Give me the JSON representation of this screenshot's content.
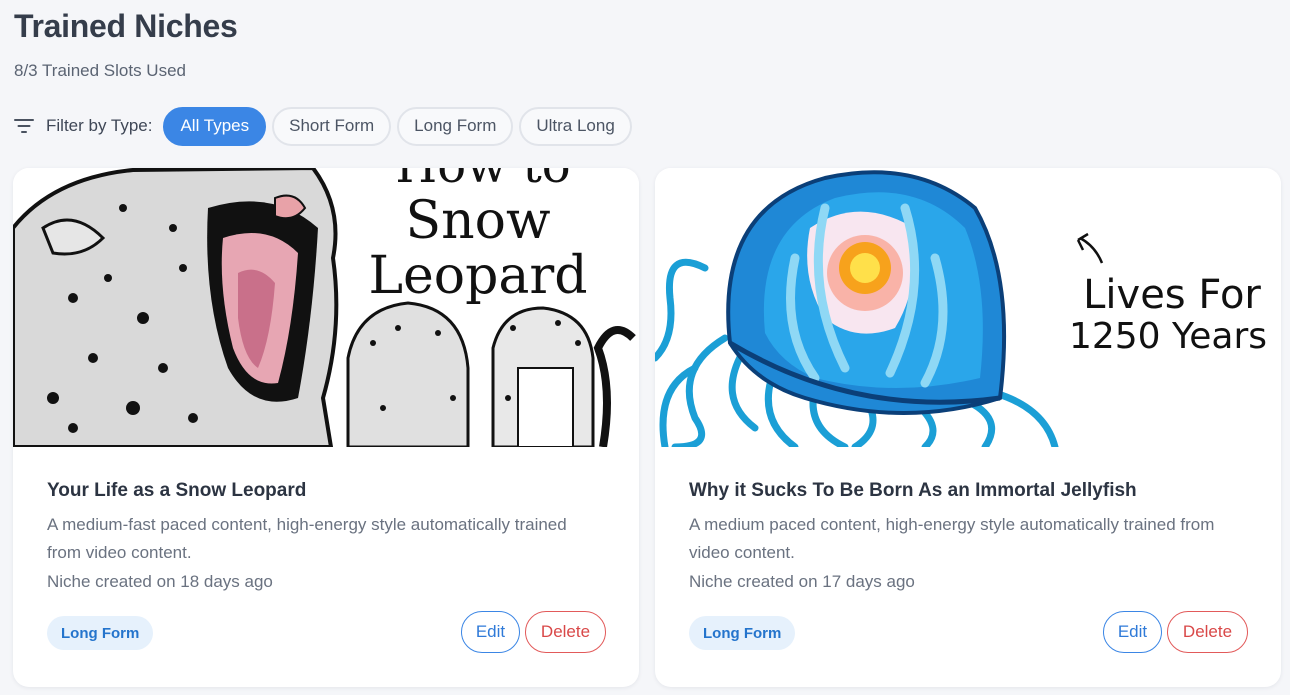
{
  "header": {
    "title": "Trained Niches",
    "slots_text": "8/3 Trained Slots Used"
  },
  "filter": {
    "label": "Filter by Type:",
    "icon": "filter-icon",
    "options": [
      "All Types",
      "Short Form",
      "Long Form",
      "Ultra Long"
    ],
    "selected": "All Types",
    "accent_color": "#3b86e5"
  },
  "cards": [
    {
      "thumbnail_text": [
        "How to",
        "Snow",
        "Leopard"
      ],
      "title": "Your Life as a Snow Leopard",
      "description": "A medium-fast paced content, high-energy style automatically trained from video content.",
      "created": "Niche created on 18 days ago",
      "badge": "Long Form",
      "edit_label": "Edit",
      "delete_label": "Delete"
    },
    {
      "thumbnail_text": [
        "Lives For",
        "1250 Years"
      ],
      "title": "Why it Sucks To Be Born As an Immortal Jellyfish",
      "description": "A medium paced content, high-energy style automatically trained from video content.",
      "created": "Niche created on 17 days ago",
      "badge": "Long Form",
      "edit_label": "Edit",
      "delete_label": "Delete"
    }
  ],
  "colors": {
    "background": "#f5f6f9",
    "badge_bg": "#e6f1fc",
    "delete": "#e25a5a"
  }
}
